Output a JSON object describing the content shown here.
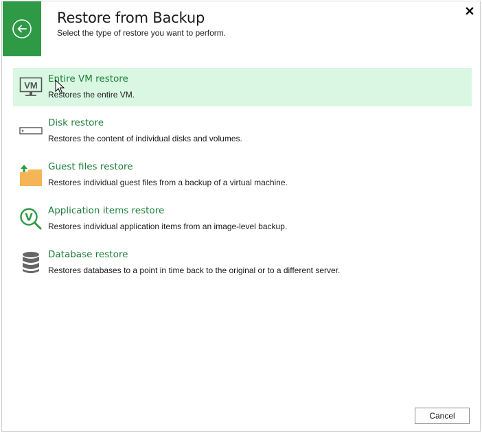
{
  "dialog": {
    "title": "Restore from Backup",
    "subtitle": "Select the type of restore you want to perform.",
    "back_icon": "back-arrow-circle-icon",
    "close_icon": "close-icon"
  },
  "options": [
    {
      "title": "Entire VM restore",
      "description": "Restores the entire VM.",
      "icon": "vm-monitor-icon",
      "icon_text": "VM",
      "selected": true
    },
    {
      "title": "Disk restore",
      "description": "Restores the content of individual disks and volumes.",
      "icon": "disk-icon",
      "selected": false
    },
    {
      "title": "Guest files restore",
      "description": "Restores individual guest files from a backup of a virtual machine.",
      "icon": "folder-upload-icon",
      "selected": false
    },
    {
      "title": "Application items restore",
      "description": "Restores individual application items from an image-level backup.",
      "icon": "application-search-icon",
      "icon_text": "V",
      "selected": false
    },
    {
      "title": "Database restore",
      "description": "Restores databases to a point in time back to the original or to a different server.",
      "icon": "database-icon",
      "selected": false
    }
  ],
  "footer": {
    "cancel_label": "Cancel"
  },
  "colors": {
    "accent_green": "#2f9a46",
    "link_green": "#1e7d3a",
    "selected_bg": "#d9f7e2"
  }
}
